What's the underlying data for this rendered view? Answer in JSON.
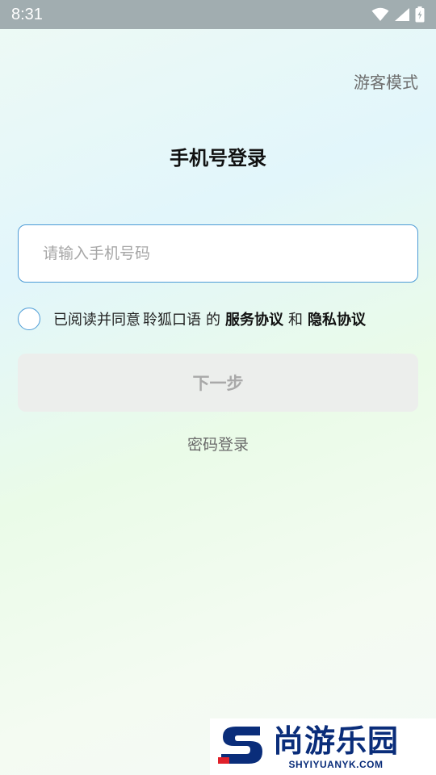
{
  "status_bar": {
    "time": "8:31",
    "icons": [
      "wifi-icon",
      "signal-icon",
      "battery-charging-icon"
    ]
  },
  "header": {
    "guest_mode": "游客模式",
    "title": "手机号登录"
  },
  "form": {
    "phone_placeholder": "请输入手机号码",
    "phone_value": "",
    "agreement": {
      "checked": false,
      "prefix": "已阅读并同意",
      "app_name": "聆狐口语",
      "connector_1": "的",
      "service_link": "服务协议",
      "connector_2": "和",
      "privacy_link": "隐私协议"
    },
    "next_button": "下一步",
    "password_login": "密码登录"
  },
  "watermark": {
    "title": "尚游乐园",
    "subtitle": "SHYIYUANYK.COM"
  },
  "colors": {
    "accent": "#4c9bd6",
    "status_bar": "#a1adb0",
    "button_disabled": "#eceeec",
    "watermark_blue": "#0a2d7a",
    "watermark_red": "#e0202a"
  }
}
